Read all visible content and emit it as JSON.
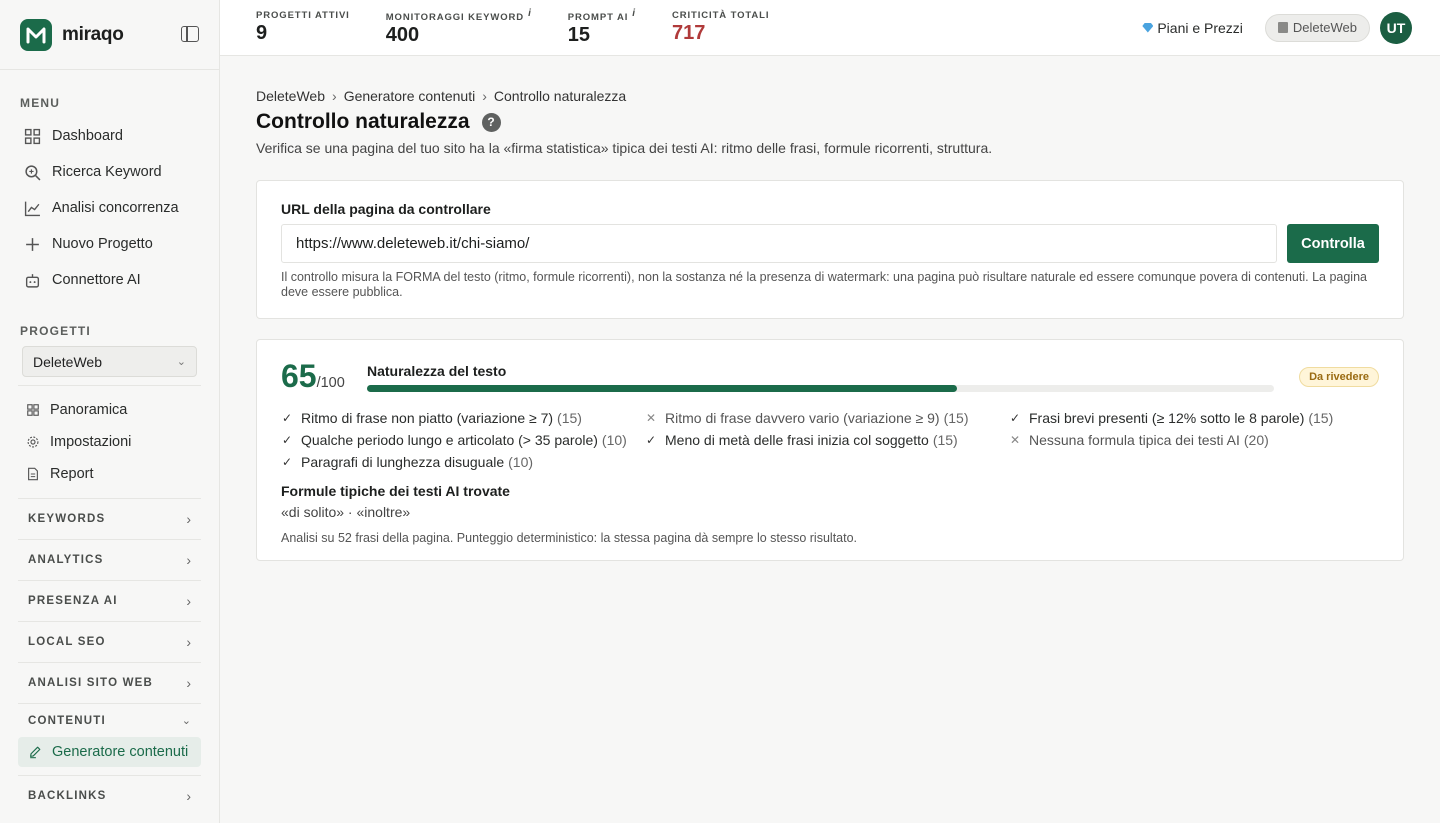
{
  "brand": {
    "name": "miraqo",
    "color": "#1b6b4a"
  },
  "sidebar": {
    "menu_title": "MENU",
    "menu": [
      {
        "label": "Dashboard",
        "icon": "grid-icon"
      },
      {
        "label": "Ricerca Keyword",
        "icon": "search-icon"
      },
      {
        "label": "Analisi concorrenza",
        "icon": "chart-line-icon"
      },
      {
        "label": "Nuovo Progetto",
        "icon": "plus-icon"
      },
      {
        "label": "Connettore AI",
        "icon": "robot-icon"
      }
    ],
    "projects_title": "PROGETTI",
    "project_selected": "DeleteWeb",
    "project_items": [
      {
        "label": "Panoramica",
        "icon": "grid-icon"
      },
      {
        "label": "Impostazioni",
        "icon": "gear-icon"
      },
      {
        "label": "Report",
        "icon": "document-icon"
      }
    ],
    "groups": [
      "KEYWORDS",
      "ANALYTICS",
      "PRESENZA AI",
      "LOCAL SEO",
      "ANALISI SITO WEB"
    ],
    "open_group": {
      "label": "CONTENUTI",
      "active_item": "Generatore contenuti"
    },
    "last_group": "BACKLINKS"
  },
  "topbar": {
    "stats": [
      {
        "label": "PROGETTI ATTIVI",
        "value": "9",
        "info": ""
      },
      {
        "label": "MONITORAGGI KEYWORD",
        "value": "400",
        "info": "i"
      },
      {
        "label": "PROMPT AI",
        "value": "15",
        "info": "i"
      },
      {
        "label": "CRITICITÀ TOTALI",
        "value": "717",
        "info": ""
      }
    ],
    "pricing": "Piani e Prezzi",
    "project_pill": "DeleteWeb",
    "avatar": "UT"
  },
  "breadcrumb": [
    "DeleteWeb",
    "Generatore contenuti",
    "Controllo naturalezza"
  ],
  "page": {
    "title": "Controllo naturalezza",
    "help": "?",
    "subtitle": "Verifica se una pagina del tuo sito ha la «firma statistica» tipica dei testi AI: ritmo delle frasi, formule ricorrenti, struttura."
  },
  "form": {
    "label": "URL della pagina da controllare",
    "url_value": "https://www.deleteweb.it/chi-siamo/",
    "button": "Controlla",
    "note": "Il controllo misura la FORMA del testo (ritmo, formule ricorrenti), non la sostanza né la presenza di watermark: una pagina può risultare naturale ed essere comunque povera di contenuti. La pagina deve essere pubblica."
  },
  "result": {
    "score": "65",
    "score_max": "/100",
    "score_fraction": 0.65,
    "bar_label": "Naturalezza del testo",
    "badge": "Da rivedere",
    "checks": [
      {
        "pass": true,
        "text": "Ritmo di frase non piatto (variazione ≥ 7)",
        "points": "(15)"
      },
      {
        "pass": false,
        "text": "Ritmo di frase davvero vario (variazione ≥ 9)",
        "points": "(15)"
      },
      {
        "pass": true,
        "text": "Frasi brevi presenti (≥ 12% sotto le 8 parole)",
        "points": "(15)"
      },
      {
        "pass": true,
        "text": "Qualche periodo lungo e articolato (> 35 parole)",
        "points": "(10)"
      },
      {
        "pass": true,
        "text": "Meno di metà delle frasi inizia col soggetto",
        "points": "(15)"
      },
      {
        "pass": false,
        "text": "Nessuna formula tipica dei testi AI",
        "points": "(20)"
      },
      {
        "pass": true,
        "text": "Paragrafi di lunghezza disuguale",
        "points": "(10)"
      }
    ],
    "formulas_title": "Formule tipiche dei testi AI trovate",
    "formulas": "«di solito» · «inoltre»",
    "footer": "Analisi su 52 frasi della pagina. Punteggio deterministico: la stessa pagina dà sempre lo stesso risultato."
  }
}
